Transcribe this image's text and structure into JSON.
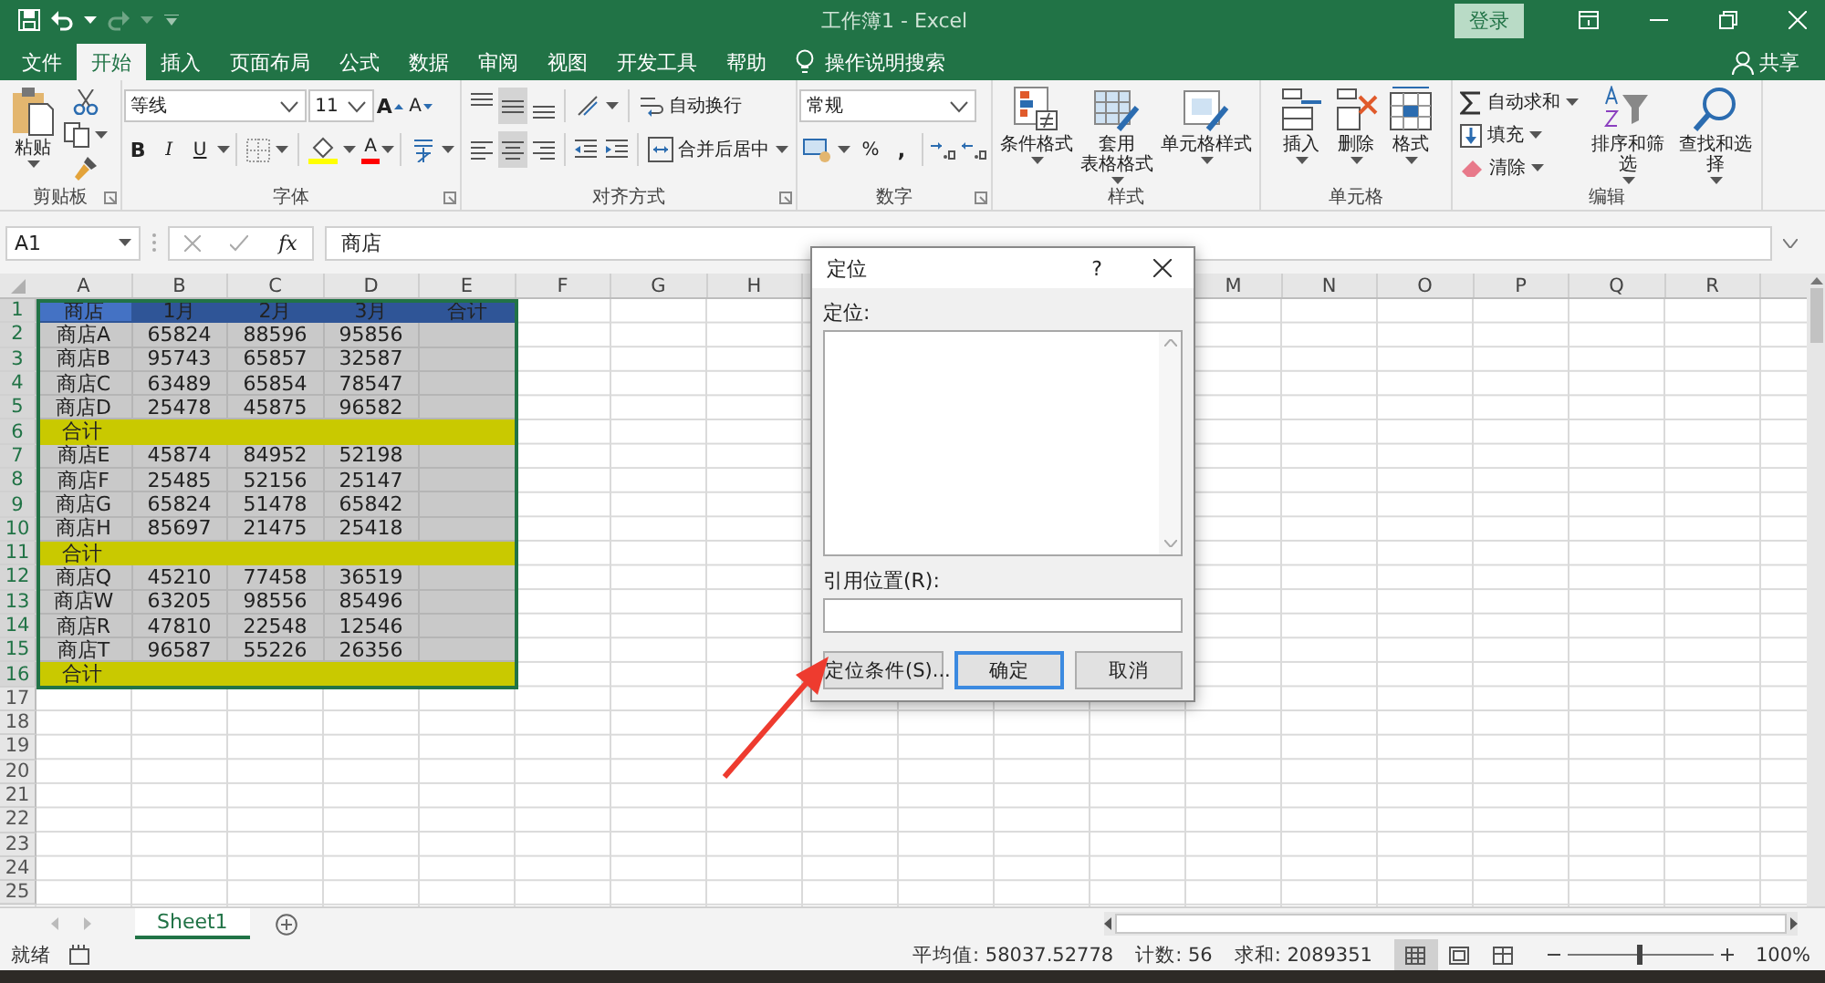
{
  "title_bar": {
    "title": "工作簿1 - Excel",
    "sign_in": "登录"
  },
  "menu_tabs": [
    {
      "label": "文件",
      "selected": false
    },
    {
      "label": "开始",
      "selected": true
    },
    {
      "label": "插入",
      "selected": false
    },
    {
      "label": "页面布局",
      "selected": false
    },
    {
      "label": "公式",
      "selected": false
    },
    {
      "label": "数据",
      "selected": false
    },
    {
      "label": "审阅",
      "selected": false
    },
    {
      "label": "视图",
      "selected": false
    },
    {
      "label": "开发工具",
      "selected": false
    },
    {
      "label": "帮助",
      "selected": false
    }
  ],
  "tell_me": "操作说明搜索",
  "share": "共享",
  "ribbon": {
    "clipboard": {
      "paste": "粘贴",
      "label": "剪贴板"
    },
    "font": {
      "font_name": "等线",
      "font_size": "11",
      "grow": "A",
      "shrink": "A",
      "bold": "B",
      "italic": "I",
      "underline": "U",
      "font_color": "A",
      "label": "字体"
    },
    "alignment": {
      "vertical": [
        {
          "selected": false
        },
        {
          "selected": true
        },
        {
          "selected": false
        }
      ],
      "horizontal": [
        {
          "selected": false
        },
        {
          "selected": true
        },
        {
          "selected": false
        }
      ],
      "wrap_text": "自动换行",
      "merge_center": "合并后居中",
      "label": "对齐方式"
    },
    "number": {
      "format": "常规",
      "percent": "%",
      "comma": ",",
      "label": "数字"
    },
    "styles": {
      "buttons": [
        {
          "lines": [
            "条件格式"
          ]
        },
        {
          "lines": [
            "套用",
            "表格格式"
          ]
        },
        {
          "lines": [
            "单元格样式"
          ]
        }
      ],
      "label": "样式"
    },
    "cells": {
      "buttons": [
        "插入",
        "删除",
        "格式"
      ],
      "label": "单元格"
    },
    "editing": {
      "autosum": "自动求和",
      "fill": "填充",
      "clear": "清除",
      "sort_filter": "排序和筛选",
      "find_select": "查找和选择",
      "label": "编辑"
    }
  },
  "formula_bar": {
    "name_box": "A1",
    "function_label": "fx",
    "content": "商店"
  },
  "sheet": {
    "column_headers": [
      "A",
      "B",
      "C",
      "D",
      "E",
      "F",
      "G",
      "H",
      "M",
      "N",
      "O",
      "P",
      "Q",
      "R"
    ],
    "rows": [
      {
        "number": "1",
        "kind": "header",
        "selected": true,
        "cells": [
          "商店",
          "1月",
          "2月",
          "3月",
          "合计"
        ]
      },
      {
        "number": "2",
        "kind": "data",
        "selected": true,
        "cells": [
          "商店A",
          "65824",
          "88596",
          "95856"
        ]
      },
      {
        "number": "3",
        "kind": "data",
        "selected": true,
        "cells": [
          "商店B",
          "95743",
          "65857",
          "32587"
        ]
      },
      {
        "number": "4",
        "kind": "data",
        "selected": true,
        "cells": [
          "商店C",
          "63489",
          "65854",
          "78547"
        ]
      },
      {
        "number": "5",
        "kind": "data",
        "selected": true,
        "cells": [
          "商店D",
          "25478",
          "45875",
          "96582"
        ]
      },
      {
        "number": "6",
        "kind": "total",
        "selected": true,
        "cells": [
          "合计"
        ]
      },
      {
        "number": "7",
        "kind": "data",
        "selected": true,
        "cells": [
          "商店E",
          "45874",
          "84952",
          "52198"
        ]
      },
      {
        "number": "8",
        "kind": "data",
        "selected": true,
        "cells": [
          "商店F",
          "25485",
          "52156",
          "25147"
        ]
      },
      {
        "number": "9",
        "kind": "data",
        "selected": true,
        "cells": [
          "商店G",
          "65824",
          "51478",
          "65842"
        ]
      },
      {
        "number": "10",
        "kind": "data",
        "selected": true,
        "cells": [
          "商店H",
          "85697",
          "21475",
          "25418"
        ]
      },
      {
        "number": "11",
        "kind": "total",
        "selected": true,
        "cells": [
          "合计"
        ]
      },
      {
        "number": "12",
        "kind": "data",
        "selected": true,
        "cells": [
          "商店Q",
          "45210",
          "77458",
          "36519"
        ]
      },
      {
        "number": "13",
        "kind": "data",
        "selected": true,
        "cells": [
          "商店W",
          "63205",
          "98556",
          "85496"
        ]
      },
      {
        "number": "14",
        "kind": "data",
        "selected": true,
        "cells": [
          "商店R",
          "47810",
          "22548",
          "12546"
        ]
      },
      {
        "number": "15",
        "kind": "data",
        "selected": true,
        "cells": [
          "商店T",
          "96587",
          "55226",
          "26356"
        ]
      },
      {
        "number": "16",
        "kind": "total",
        "selected": true,
        "cells": [
          "合计"
        ]
      },
      {
        "number": "17",
        "kind": "empty",
        "selected": false
      },
      {
        "number": "18",
        "kind": "empty",
        "selected": false
      },
      {
        "number": "19",
        "kind": "empty",
        "selected": false
      },
      {
        "number": "20",
        "kind": "empty",
        "selected": false
      },
      {
        "number": "21",
        "kind": "empty",
        "selected": false
      },
      {
        "number": "22",
        "kind": "empty",
        "selected": false
      },
      {
        "number": "23",
        "kind": "empty",
        "selected": false
      },
      {
        "number": "24",
        "kind": "empty",
        "selected": false
      },
      {
        "number": "25",
        "kind": "empty",
        "selected": false
      }
    ]
  },
  "dialog": {
    "title": "定位",
    "help": "?",
    "goto_label": "定位:",
    "reference_label": "引用位置(R):",
    "buttons": [
      {
        "label": "定位条件(S)...",
        "default": false
      },
      {
        "label": "确定",
        "default": true
      },
      {
        "label": "取消",
        "default": false
      }
    ]
  },
  "sheet_tabs": [
    {
      "label": "Sheet1",
      "selected": true
    }
  ],
  "status_bar": {
    "ready": "就绪",
    "average": "平均值: 58037.52778",
    "count": "计数: 56",
    "sum": "求和: 2089351",
    "views": [
      {
        "selected": true
      },
      {
        "selected": false
      },
      {
        "selected": false
      }
    ],
    "zoom": {
      "level": 0.5
    },
    "zoom_text": "100%"
  }
}
